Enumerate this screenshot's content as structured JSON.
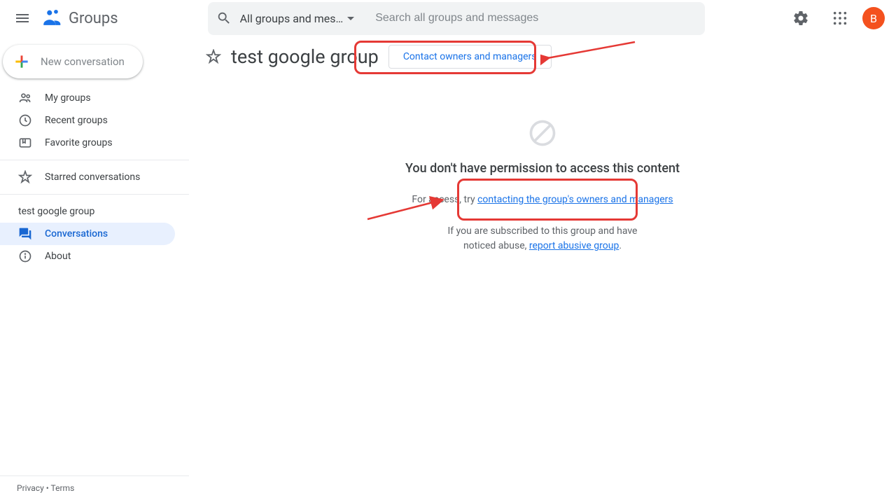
{
  "header": {
    "app_name": "Groups",
    "search_scope": "All groups and mes…",
    "search_placeholder": "Search all groups and messages",
    "avatar_initial": "B"
  },
  "sidebar": {
    "new_conversation": "New conversation",
    "items": [
      {
        "label": "My groups"
      },
      {
        "label": "Recent groups"
      },
      {
        "label": "Favorite groups"
      }
    ],
    "starred": "Starred conversations",
    "group_name": "test google group",
    "group_items": [
      {
        "label": "Conversations"
      },
      {
        "label": "About"
      }
    ],
    "footer": {
      "privacy": "Privacy",
      "terms": "Terms",
      "sep": " • "
    }
  },
  "main": {
    "group_title": "test google group",
    "contact_button": "Contact owners and managers",
    "no_permission": "You don't have permission to access this content",
    "access_prefix": "For access, try ",
    "access_link": "contacting the group's owners and managers",
    "abuse_prefix": "If you are subscribed to this group and have noticed abuse, ",
    "abuse_link": "report abusive group",
    "abuse_suffix": "."
  }
}
